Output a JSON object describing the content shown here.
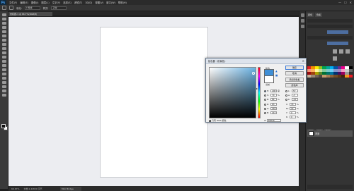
{
  "app": {
    "logo": "Ps",
    "menus": [
      "文件(F)",
      "编辑(E)",
      "图像(I)",
      "图层(L)",
      "文字(Y)",
      "选择(S)",
      "滤镜(T)",
      "3D(D)",
      "视图(V)",
      "窗口(W)",
      "帮助(H)"
    ],
    "window_controls": [
      "—",
      "☐",
      "✕"
    ]
  },
  "options_bar": {
    "feather_label": "羽化:",
    "feather_value": "0 像素",
    "style_label": "样式:",
    "style_value": "正常"
  },
  "document": {
    "tab_label": "未标题-1 @ 66.7%(RGB/8)"
  },
  "status_bar": {
    "zoom": "66.67%",
    "doc_info": "文档:1.24M/0 字节"
  },
  "bottom_tab": "Mini Bridge",
  "right_panel": {
    "tabs": [
      "颜色",
      "色板"
    ],
    "layers_tabs": [
      "图层",
      "通道",
      "路径"
    ],
    "layer_name": "背景"
  },
  "color_picker": {
    "title": "拾色器（前景色）",
    "close": "✕",
    "new_label": "新的",
    "current_label": "当前",
    "new_color": "#3f8fd6",
    "current_color": "#ffffff",
    "buttons": {
      "ok": "确定",
      "cancel": "取消",
      "add_swatch": "添加到色板",
      "color_libraries": "颜色库"
    },
    "fields": {
      "H": {
        "value": "208",
        "unit": "度"
      },
      "S": {
        "value": "70",
        "unit": "%"
      },
      "B": {
        "value": "84",
        "unit": "%"
      },
      "R": {
        "value": "63",
        "unit": ""
      },
      "G": {
        "value": "143",
        "unit": ""
      },
      "Bl": {
        "value": "214",
        "unit": ""
      },
      "L": {
        "value": "57",
        "unit": ""
      },
      "a": {
        "value": "-3",
        "unit": ""
      },
      "b": {
        "value": "-47",
        "unit": ""
      },
      "C": {
        "value": "74",
        "unit": "%"
      },
      "M": {
        "value": "37",
        "unit": "%"
      },
      "Y": {
        "value": "0",
        "unit": "%"
      },
      "K": {
        "value": "0",
        "unit": "%"
      }
    },
    "labels": {
      "H": "H:",
      "S": "S:",
      "B": "B:",
      "R": "R:",
      "G": "G:",
      "Bl": "B:",
      "L": "L:",
      "a": "a:",
      "b": "b:",
      "C": "C:",
      "M": "M:",
      "Y": "Y:",
      "K": "K:"
    },
    "web_only": "只有 Web 颜色",
    "hex_prefix": "#",
    "hex": "3f8fd6"
  }
}
